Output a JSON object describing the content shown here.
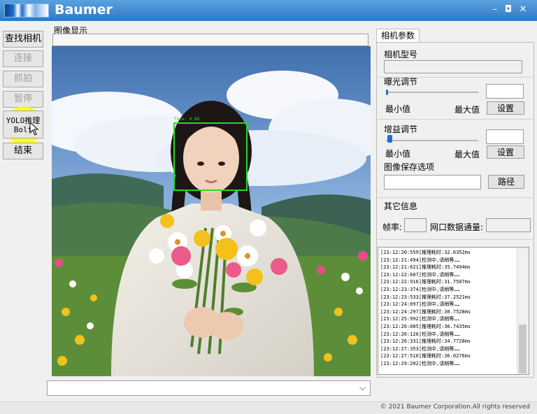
{
  "window": {
    "title": "Baumer",
    "minimize": "–",
    "maximize": "◘",
    "close": "✕"
  },
  "left_buttons": [
    {
      "label": "查找相机",
      "enabled": true
    },
    {
      "label": "连接",
      "enabled": false
    },
    {
      "label": "抓拍",
      "enabled": false
    },
    {
      "label": "暂停",
      "enabled": false
    },
    {
      "label": "YOLO推理",
      "sub": "Bolt",
      "enabled": true
    },
    {
      "label": "结束",
      "enabled": true
    }
  ],
  "image_display": {
    "label": "图像显示",
    "detection": {
      "label": "face: 0.88",
      "color": "#22dd22"
    }
  },
  "right_panel": {
    "tab": "相机参数",
    "model_label": "相机型号",
    "exposure": {
      "title": "曝光调节",
      "min_label": "最小值",
      "max_label": "最大值",
      "set_label": "设置",
      "level": 0.02
    },
    "gain": {
      "title": "增益调节",
      "min_label": "最小值",
      "max_label": "最大值",
      "set_label": "设置",
      "level": 0.02
    },
    "save": {
      "title": "图像保存选项",
      "path_button": "路径"
    },
    "other": {
      "title": "其它信息",
      "fps_label": "帧率:",
      "channel_label": "网口数据通量:"
    }
  },
  "log": [
    "[23:12:20:559]推理耗时:32.6352ms",
    "[23:12:21:494]检测中,请稍等……",
    "[23:12:21:621]推理耗时:35.7494ms",
    "[23:12:22:607]检测中,请稍等……",
    "[23:12:22:916]推理耗时:31.7507ms",
    "[23:12:23:374]检测中,请稍等……",
    "[23:12:23:533]推理耗时:37.2521ms",
    "[23:12:24:097]检测中,请稍等……",
    "[23:12:24:297]推理耗时:30.7528ms",
    "[23:12:25:992]检测中,请稍等……",
    "[23:12:26:085]推理耗时:36.7435ms",
    "[23:12:26:126]检测中,请稍等……",
    "[23:12:26:331]推理耗时:34.7728ms",
    "[23:12:27:353]检测中,请稍等……",
    "[23:12:27:510]推理耗时:36.0276ms",
    "[23:12:29:202]检测中,请稍等……"
  ],
  "footer": {
    "copyright": "© 2021 Baumer Corporation.All rights reserved"
  }
}
